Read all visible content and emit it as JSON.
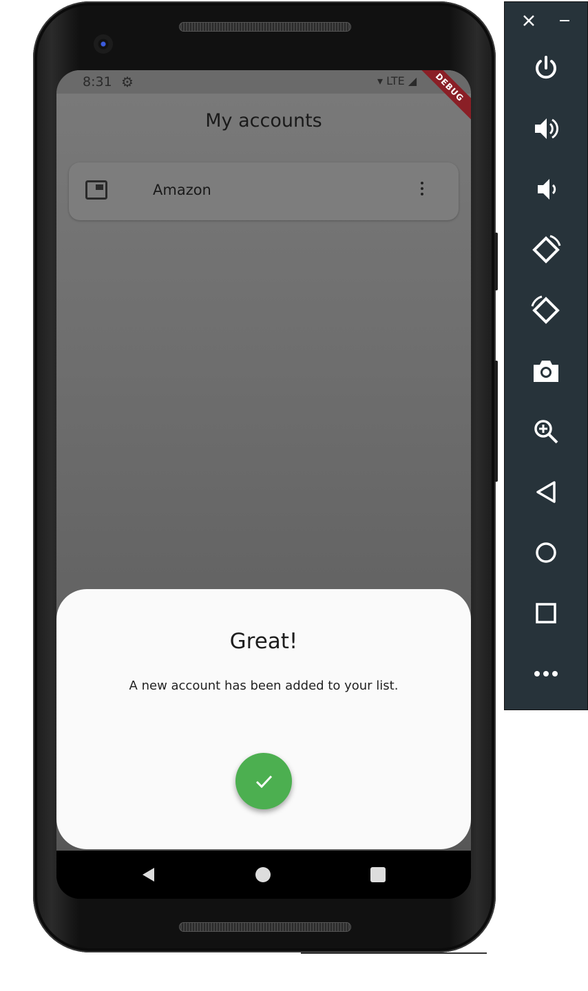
{
  "status_bar": {
    "time": "8:31",
    "network": "LTE",
    "debug_banner": "DEBUG"
  },
  "app": {
    "title": "My accounts",
    "accounts": [
      {
        "label": "Amazon",
        "icon": "picture-in-picture-icon"
      }
    ]
  },
  "dialog": {
    "title": "Great!",
    "message": "A new account has been added to your list.",
    "confirm_icon": "check-icon",
    "accent_color": "#4caf50"
  },
  "nav_bar": {
    "icons": [
      "back-icon",
      "home-icon",
      "recents-icon"
    ]
  },
  "emulator_toolbar": {
    "controls": [
      "close-icon",
      "minimize-icon"
    ],
    "buttons": [
      "power-icon",
      "volume-up-icon",
      "volume-down-icon",
      "rotate-left-icon",
      "rotate-right-icon",
      "camera-icon",
      "zoom-icon",
      "back-icon",
      "home-icon",
      "overview-icon",
      "more-icon"
    ]
  }
}
